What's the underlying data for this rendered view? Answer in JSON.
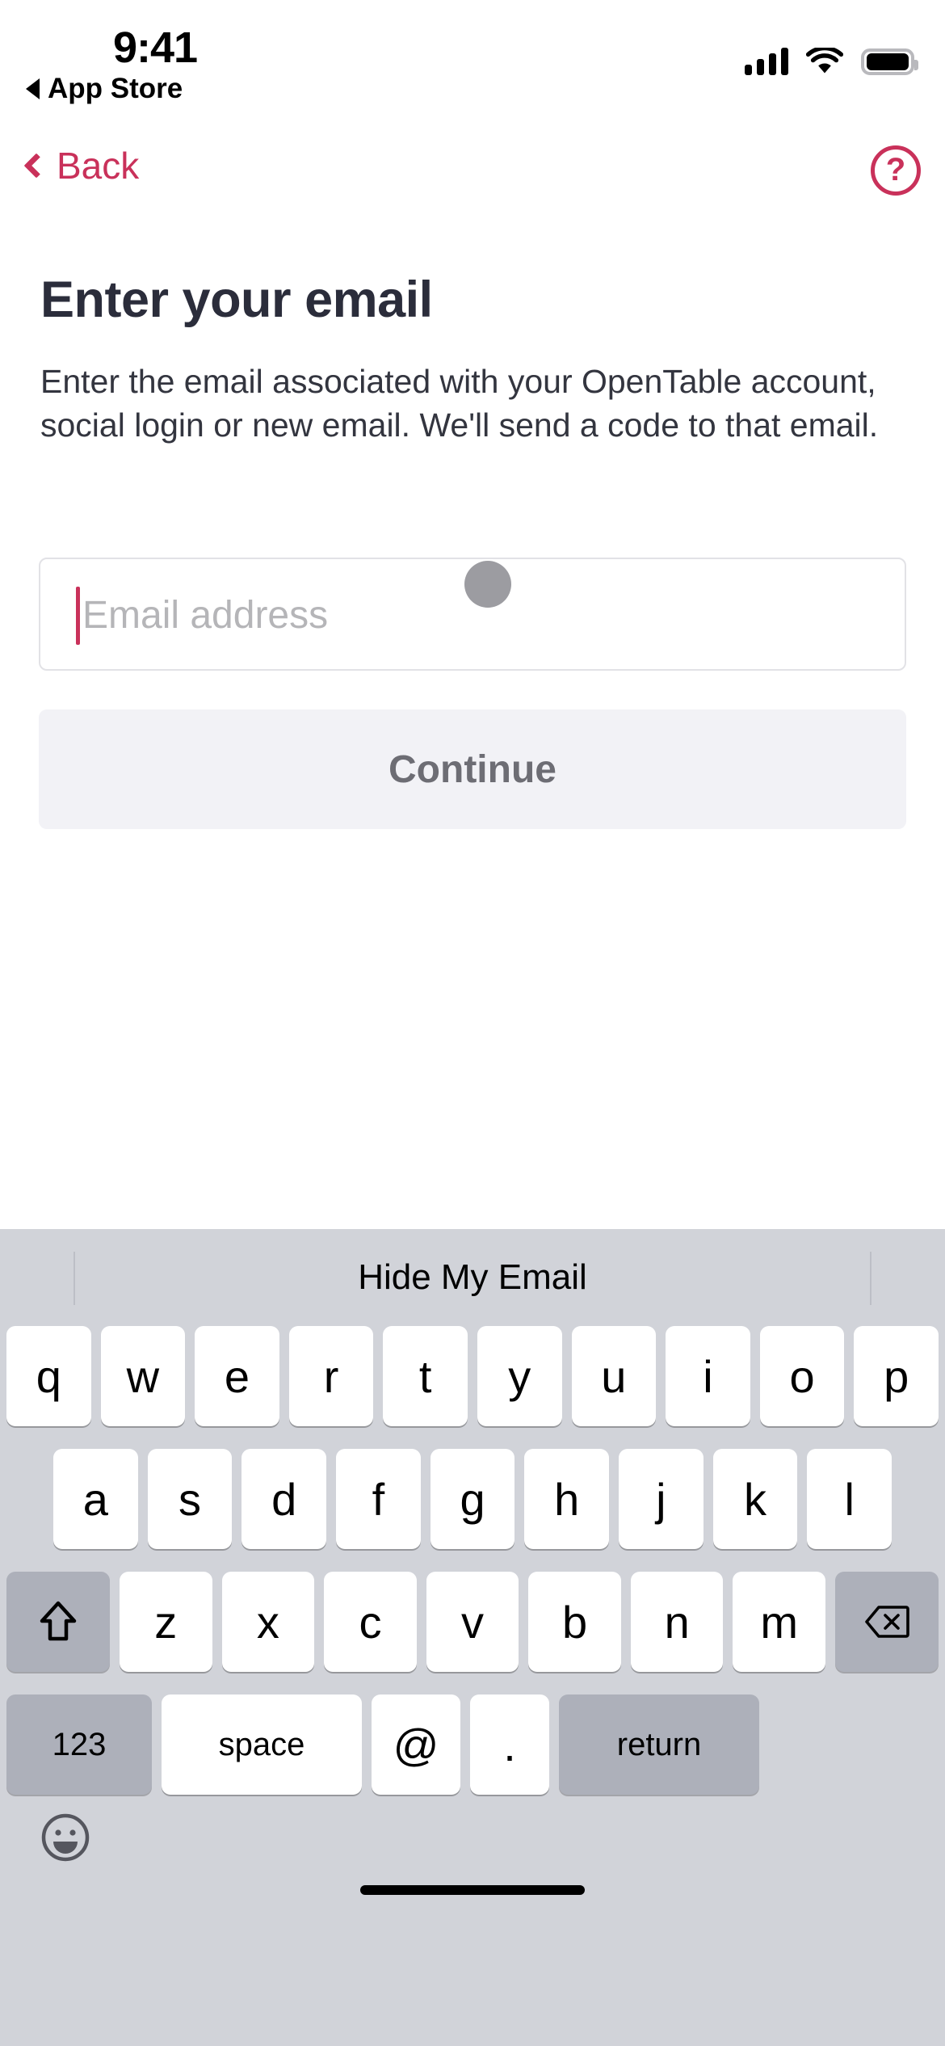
{
  "status_bar": {
    "time": "9:41",
    "return_app_label": "App Store",
    "return_app_icon": "triangle-left-icon",
    "signal_icon": "cellular-signal-icon",
    "wifi_icon": "wifi-icon",
    "battery_icon": "battery-full-icon"
  },
  "nav": {
    "back_label": "Back",
    "back_icon": "chevron-left-icon",
    "help_icon": "question-mark-circle-icon",
    "help_label": "?"
  },
  "main": {
    "title": "Enter your email",
    "description": "Enter the email associated with your OpenTable account, social login or new email. We'll send a code to that email.",
    "email_input": {
      "value": "",
      "placeholder": "Email address"
    },
    "continue_label": "Continue"
  },
  "keyboard": {
    "suggestion": "Hide My Email",
    "row1": [
      "q",
      "w",
      "e",
      "r",
      "t",
      "y",
      "u",
      "i",
      "o",
      "p"
    ],
    "row2": [
      "a",
      "s",
      "d",
      "f",
      "g",
      "h",
      "j",
      "k",
      "l"
    ],
    "row3": [
      "z",
      "x",
      "c",
      "v",
      "b",
      "n",
      "m"
    ],
    "shift_icon": "shift-arrow-icon",
    "delete_icon": "backspace-icon",
    "numeric_label": "123",
    "space_label": "space",
    "at_label": "@",
    "period_label": ".",
    "return_label": "return",
    "emoji_icon": "smiley-face-icon"
  },
  "colors": {
    "accent": "#C9315A",
    "title": "#2B2D3B",
    "body_text": "#33353F",
    "placeholder": "#B5B5B8",
    "button_disabled_bg": "#F2F2F6",
    "button_disabled_text": "#6D6D74",
    "keyboard_bg": "#D1D3D9",
    "key_bg": "#FFFFFF",
    "key_fn_bg": "#ADB0BA"
  }
}
